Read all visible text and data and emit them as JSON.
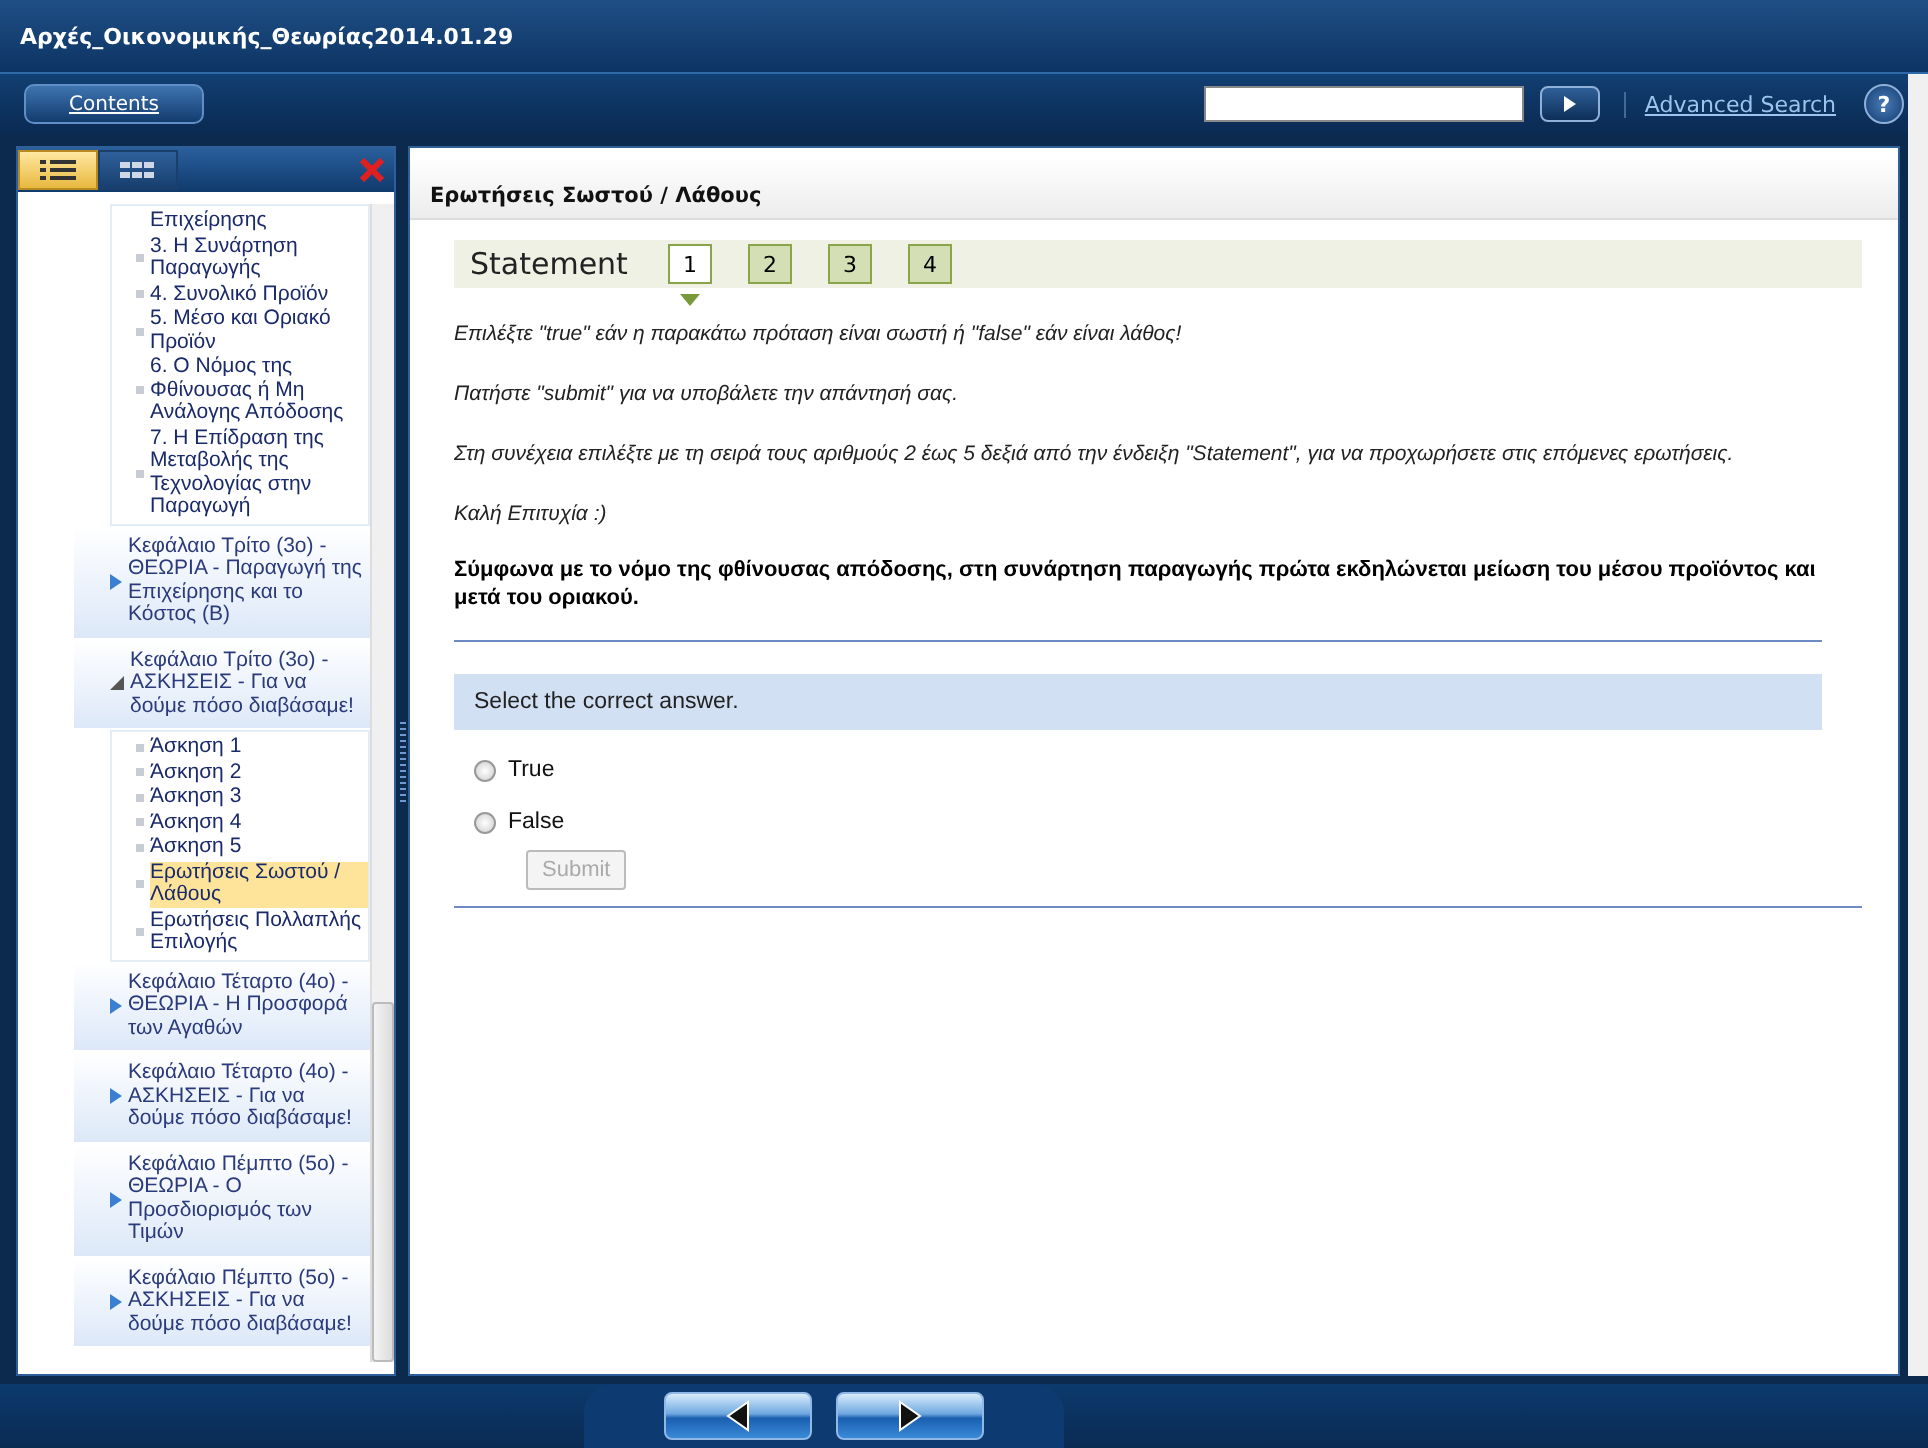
{
  "window": {
    "title": "Αρχές_Οικονομικής_Θεωρίας2014.01.29"
  },
  "toolbar": {
    "contents_button": "Contents",
    "advanced_search": "Advanced Search",
    "help": "?"
  },
  "sidebar": {
    "view_tabs": [
      {
        "kind": "list",
        "selected": true
      },
      {
        "kind": "grid",
        "selected": false
      }
    ],
    "tree": [
      {
        "expanded": true,
        "children": [
          {
            "label": "Επιχείρησης",
            "selected": false,
            "bullet": false
          },
          {
            "label": "3. Η Συνάρτηση Παραγωγής",
            "selected": false,
            "bullet": true
          },
          {
            "label": "4. Συνολικό Προϊόν",
            "selected": false,
            "bullet": true
          },
          {
            "label": "5. Μέσο και Οριακό Προϊόν",
            "selected": false,
            "bullet": true
          },
          {
            "label": "6. Ο Νόμος της Φθίνουσας ή Μη Ανάλογης Απόδοσης",
            "selected": false,
            "bullet": true
          },
          {
            "label": "7. Η Επίδραση της Μεταβολής της Τεχνολογίας στην Παραγωγή",
            "selected": false,
            "bullet": true
          }
        ]
      },
      {
        "label": "Κεφάλαιο Τρίτο (3ο) - ΘΕΩΡΙΑ - Παραγωγή της Επιχείρησης και το Κόστος (Β)",
        "expanded": false
      },
      {
        "label": "Κεφάλαιο Τρίτο (3ο) - ΑΣΚΗΣΕΙΣ - Για να δούμε πόσο διαβάσαμε!",
        "expanded": true,
        "children": [
          {
            "label": "Άσκηση 1",
            "selected": false,
            "bullet": true
          },
          {
            "label": "Άσκηση 2",
            "selected": false,
            "bullet": true
          },
          {
            "label": "Άσκηση 3",
            "selected": false,
            "bullet": true
          },
          {
            "label": "Άσκηση 4",
            "selected": false,
            "bullet": true
          },
          {
            "label": "Άσκηση 5",
            "selected": false,
            "bullet": true
          },
          {
            "label": "Ερωτήσεις Σωστού / Λάθους",
            "selected": true,
            "bullet": true
          },
          {
            "label": "Ερωτήσεις Πολλαπλής Επιλογής",
            "selected": false,
            "bullet": true
          }
        ]
      },
      {
        "label": "Κεφάλαιο Τέταρτο (4ο) - ΘΕΩΡΙΑ - Η Προσφορά των Αγαθών",
        "expanded": false
      },
      {
        "label": "Κεφάλαιο Τέταρτο (4ο) - ΑΣΚΗΣΕΙΣ - Για να δούμε πόσο διαβάσαμε!",
        "expanded": false
      },
      {
        "label": "Κεφάλαιο Πέμπτο (5ο) - ΘΕΩΡΙΑ - Ο Προσδιορισμός των Τιμών",
        "expanded": false
      },
      {
        "label": "Κεφάλαιο Πέμπτο (5ο) - ΑΣΚΗΣΕΙΣ - Για να δούμε πόσο διαβάσαμε!",
        "expanded": false
      }
    ]
  },
  "content": {
    "title": "Ερωτήσεις Σωστού / Λάθους",
    "statement_label": "Statement",
    "statement_tabs": [
      {
        "label": "1",
        "selected": true
      },
      {
        "label": "2",
        "selected": false
      },
      {
        "label": "3",
        "selected": false
      },
      {
        "label": "4",
        "selected": false
      }
    ],
    "instructions": [
      "Επιλέξτε \"true\" εάν η παρακάτω πρόταση είναι σωστή ή \"false\" εάν είναι λάθος!",
      "Πατήστε \"submit\" για να υποβάλετε την απάντησή σας.",
      "Στη συνέχεια επιλέξτε με τη σειρά τους αριθμούς 2 έως 5 δεξιά από την ένδειξη \"Statement\", για να προχωρήσετε στις επόμενες ερωτήσεις.",
      "Καλή Επιτυχία  :)"
    ],
    "statement": "Σύμφωνα με το νόμο της φθίνουσας απόδοσης, στη συνάρτηση παραγωγής πρώτα εκδηλώνεται μείωση του μέσου προϊόντος και μετά του οριακού.",
    "prompt": "Select the correct answer.",
    "options": [
      {
        "label": "True",
        "selected": false
      },
      {
        "label": "False",
        "selected": false
      }
    ],
    "submit": {
      "label": "Submit",
      "disabled": true
    }
  }
}
